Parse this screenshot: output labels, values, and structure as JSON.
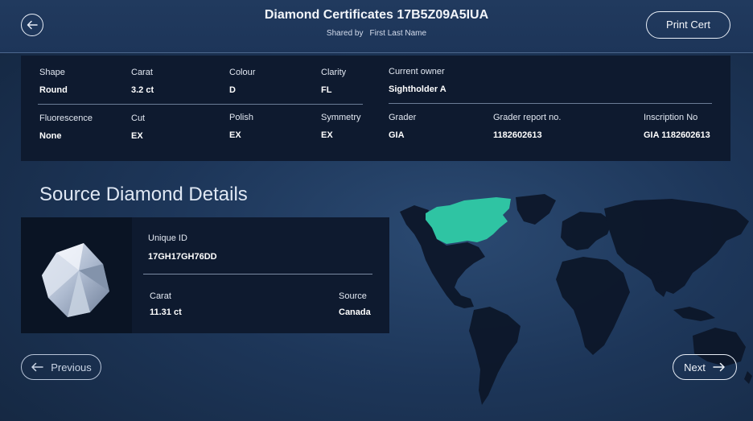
{
  "header": {
    "title": "Diamond Certificates 17B5Z09A5IUA",
    "shared_by_label": "Shared by",
    "shared_by_name": "First Last Name",
    "print_label": "Print Cert",
    "back_icon": "arrow-left-circle-icon"
  },
  "certificate": {
    "shape": {
      "label": "Shape",
      "value": "Round"
    },
    "carat": {
      "label": "Carat",
      "value": "3.2 ct"
    },
    "colour": {
      "label": "Colour",
      "value": "D"
    },
    "clarity": {
      "label": "Clarity",
      "value": "FL"
    },
    "fluorescence": {
      "label": "Fluorescence",
      "value": "None"
    },
    "cut": {
      "label": "Cut",
      "value": "EX"
    },
    "polish": {
      "label": "Polish",
      "value": "EX"
    },
    "symmetry": {
      "label": "Symmetry",
      "value": "EX"
    },
    "current_owner": {
      "label": "Current owner",
      "value": "Sightholder A"
    },
    "grader": {
      "label": "Grader",
      "value": "GIA"
    },
    "grader_report": {
      "label": "Grader report no.",
      "value": "1182602613"
    },
    "inscription": {
      "label": "Inscription No",
      "value": "GIA 1182602613"
    }
  },
  "source": {
    "section_title": "Source Diamond Details",
    "unique_id": {
      "label": "Unique ID",
      "value": "17GH17GH76DD"
    },
    "carat": {
      "label": "Carat",
      "value": "11.31 ct"
    },
    "origin": {
      "label": "Source",
      "value": "Canada"
    },
    "highlight_color": "#2fc4a3"
  },
  "nav": {
    "previous_label": "Previous",
    "next_label": "Next"
  }
}
